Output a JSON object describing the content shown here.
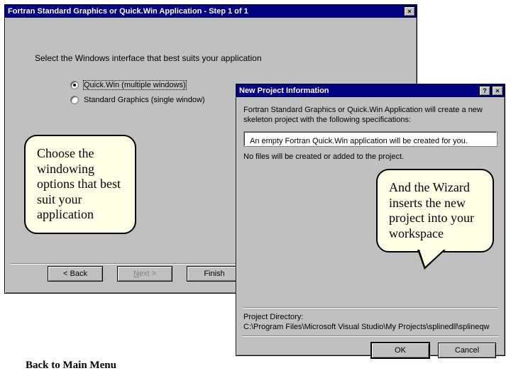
{
  "dialog1": {
    "title": "Fortran Standard Graphics or Quick.Win Application - Step 1 of 1",
    "instruction": "Select the Windows interface that best suits your application",
    "options": {
      "quickwin": "Quick.Win (multiple windows)",
      "stdgraphics": "Standard Graphics (single window)"
    },
    "buttons": {
      "back": "< Back",
      "next": "Next >",
      "finish": "Finish"
    }
  },
  "dialog2": {
    "title": "New Project Information",
    "description": "Fortran Standard Graphics or Quick.Win Application will create a new skeleton project with the following specifications:",
    "box_text": "An empty Fortran Quick.Win application will be created for you.",
    "body_text": "No files will be created or added to the project.",
    "dir_label": "Project Directory:",
    "dir_path": "C:\\Program Files\\Microsoft Visual Studio\\My Projects\\splinedll\\splineqw",
    "buttons": {
      "ok": "OK",
      "cancel": "Cancel"
    }
  },
  "callouts": {
    "left": "Choose the windowing options that best suit your application",
    "right": "And the Wizard inserts the new project into your workspace"
  },
  "back_link": "Back to Main Menu",
  "glyphs": {
    "close": "×",
    "help": "?"
  }
}
